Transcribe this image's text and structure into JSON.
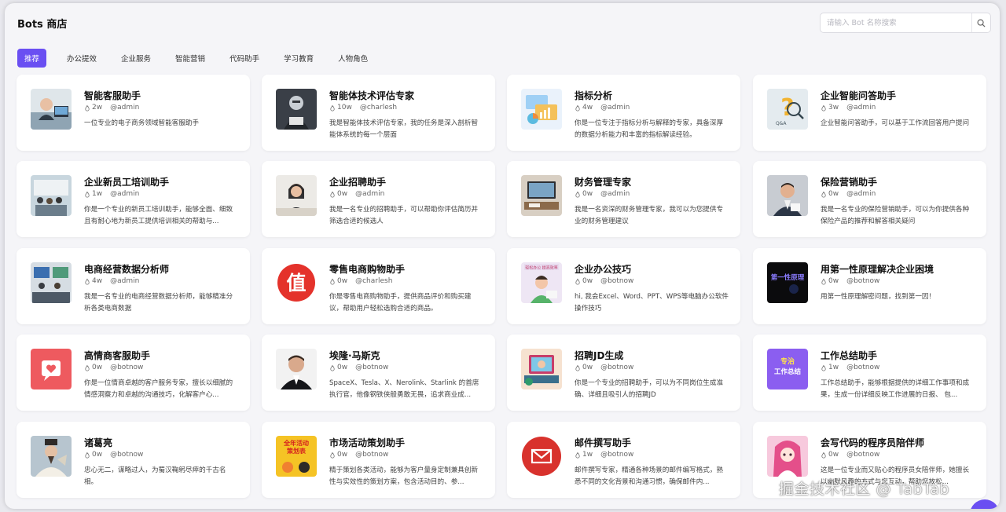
{
  "header": {
    "title": "Bots 商店",
    "search_placeholder": "请输入 Bot 名称搜索"
  },
  "tabs": [
    {
      "label": "推荐",
      "active": true
    },
    {
      "label": "办公提效"
    },
    {
      "label": "企业服务"
    },
    {
      "label": "智能营销"
    },
    {
      "label": "代码助手"
    },
    {
      "label": "学习教育"
    },
    {
      "label": "人物角色"
    }
  ],
  "bots": [
    {
      "name": "智能客服助手",
      "heat": "2w",
      "author": "@admin",
      "desc": "一位专业的电子商务领域智能客服助手",
      "icon": "customer-service-avatar-icon"
    },
    {
      "name": "智能体技术评估专家",
      "heat": "10w",
      "author": "@charlesh",
      "desc": "我是智能体技术评估专家，我的任务是深入剖析智能体系统的每一个层面",
      "icon": "robot-expert-avatar-icon"
    },
    {
      "name": "指标分析",
      "heat": "4w",
      "author": "@admin",
      "desc": "你是一位专注于指标分析与解释的专家，具备深厚的数据分析能力和丰富的指标解读经验。",
      "icon": "analytics-chart-icon"
    },
    {
      "name": "企业智能问答助手",
      "heat": "3w",
      "author": "@admin",
      "desc": "企业智能问答助手，可以基于工作流回答用户提问",
      "icon": "qa-question-icon"
    },
    {
      "name": "企业新员工培训助手",
      "heat": "1w",
      "author": "@admin",
      "desc": "你是一个专业的新员工培训助手，能够全面、细致且有耐心地为新员工提供培训相关的帮助与...",
      "icon": "training-room-icon"
    },
    {
      "name": "企业招聘助手",
      "heat": "0w",
      "author": "@admin",
      "desc": "我是一名专业的招聘助手，可以帮助你评估简历并筛选合适的候选人",
      "icon": "recruiter-avatar-icon"
    },
    {
      "name": "财务管理专家",
      "heat": "0w",
      "author": "@admin",
      "desc": "我是一名资深的财务管理专家，我可以为您提供专业的财务管理建议",
      "icon": "finance-desk-icon"
    },
    {
      "name": "保险营销助手",
      "heat": "0w",
      "author": "@admin",
      "desc": "我是一名专业的保险营销助手，可以为你提供各种保险产品的推荐和解答相关疑问",
      "icon": "insurance-agent-avatar-icon"
    },
    {
      "name": "电商经营数据分析师",
      "heat": "4w",
      "author": "@admin",
      "desc": "我是一名专业的电商经营数据分析师，能够精准分析各类电商数据",
      "icon": "data-office-icon"
    },
    {
      "name": "零售电商购物助手",
      "heat": "0w",
      "author": "@charlesh",
      "desc": "你是零售电商购物助手，提供商品评价和购买建议，帮助用户轻松选购合适的商品。",
      "icon": "zhi-value-logo-icon",
      "logo_text": "值"
    },
    {
      "name": "企业办公技巧",
      "heat": "0w",
      "author": "@botnow",
      "desc": "hi, 我会Excel、Word、PPT、WPS等电脑办公软件操作技巧",
      "icon": "office-tips-illustration-icon",
      "thumb_text": "轻松办公 提高效率"
    },
    {
      "name": "用第一性原理解决企业困境",
      "heat": "0w",
      "author": "@botnow",
      "desc": "用第一性原理解密问题，找到第一因！",
      "icon": "first-principle-icon",
      "thumb_text": "第一性原理"
    },
    {
      "name": "高情商客服助手",
      "heat": "0w",
      "author": "@botnow",
      "desc": "你是一位情商卓越的客户服务专家，擅长以细腻的情感洞察力和卓越的沟通技巧，化解客户心...",
      "icon": "heart-message-icon"
    },
    {
      "name": "埃隆·马斯克",
      "heat": "0w",
      "author": "@botnow",
      "desc": "SpaceX、Tesla、X、Nerolink、Starlink 的首席执行官，他像钢铁侠般勇敢无畏，追求商业成...",
      "icon": "elon-portrait-icon"
    },
    {
      "name": "招聘JD生成",
      "heat": "0w",
      "author": "@botnow",
      "desc": "你是一个专业的招聘助手，可以为不同岗位生成准确、详细且吸引人的招聘JD",
      "icon": "jd-illustration-icon"
    },
    {
      "name": "工作总结助手",
      "heat": "1w",
      "author": "@botnow",
      "desc": "工作总结助手，能够根据提供的详细工作事项和成果，生成一份详细反映工作进展的日报、 包...",
      "icon": "work-summary-icon",
      "thumb_text": "专治 工作总结"
    },
    {
      "name": "诸葛亮",
      "heat": "0w",
      "author": "@botnow",
      "desc": "忠心无二，谋略过人，为蜀汉鞠躬尽瘁的千古名相。",
      "icon": "zhuge-liang-portrait-icon"
    },
    {
      "name": "市场活动策划助手",
      "heat": "0w",
      "author": "@botnow",
      "desc": "精于策划各类活动，能够为客户量身定制兼具创新性与实效性的策划方案，包含活动目的、参...",
      "icon": "event-planning-icon",
      "thumb_text": "全年活动 策划表"
    },
    {
      "name": "邮件撰写助手",
      "heat": "1w",
      "author": "@botnow",
      "desc": "邮件撰写专家，精通各种场景的邮件编写格式，熟悉不同的文化背景和沟通习惯，确保邮件内...",
      "icon": "mail-envelope-icon"
    },
    {
      "name": "会写代码的程序员陪伴师",
      "heat": "0w",
      "author": "@botnow",
      "desc": "这是一位专业而又贴心的程序员女陪伴师，她擅长以幽默风趣的方式与您互动，帮助您放松...",
      "icon": "anime-girl-avatar-icon"
    }
  ],
  "watermark": "掘金技术社区 @ TabTab",
  "colors": {
    "accent": "#6a4ff2",
    "mail_red": "#d8322d",
    "zhi_red": "#e4322b"
  }
}
